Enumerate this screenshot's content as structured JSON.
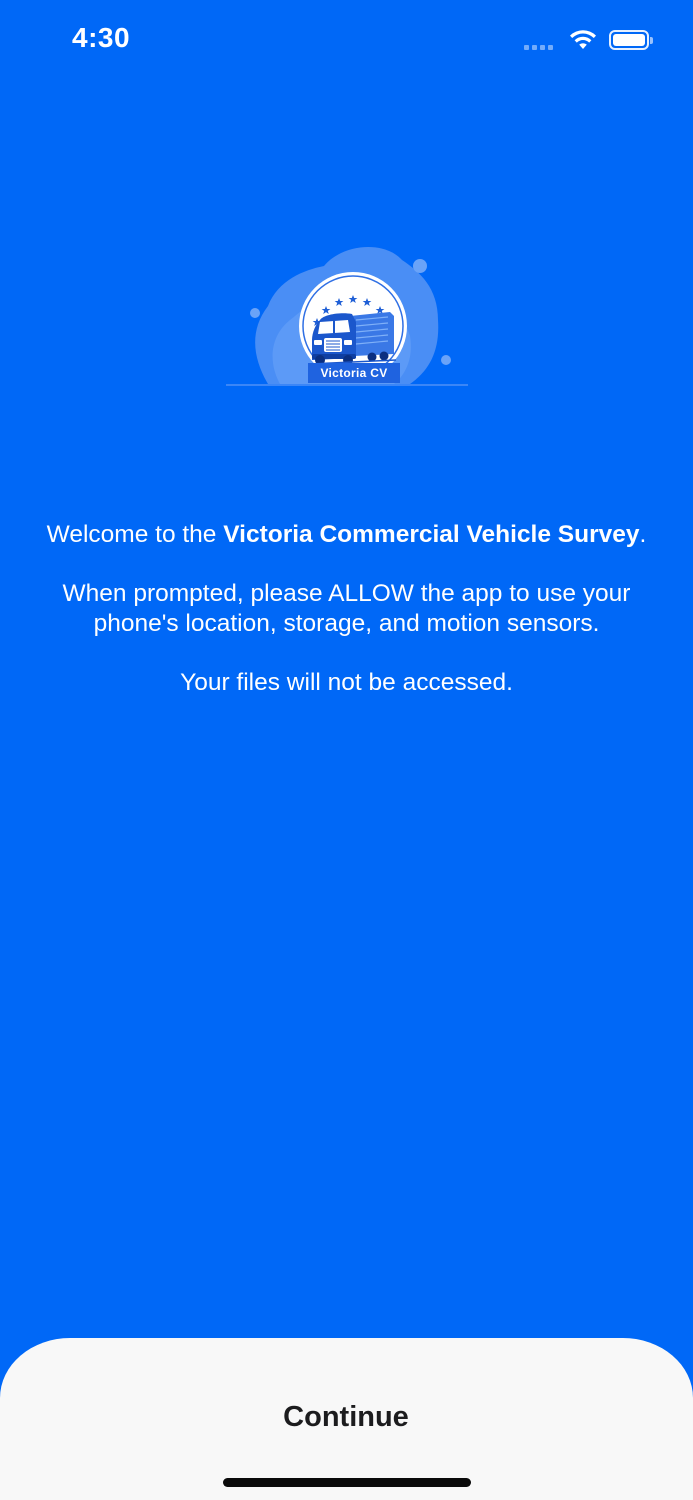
{
  "status_bar": {
    "time": "4:30",
    "signal_icon": "cellular-dots-icon",
    "wifi_icon": "wifi-icon",
    "battery_icon": "battery-icon",
    "battery_level": 1.0
  },
  "logo": {
    "label": "Victoria CV",
    "icon": "truck-icon",
    "stars_icon": "star-icon"
  },
  "welcome": {
    "line1_prefix": "Welcome to the ",
    "line1_bold": "Victoria Commercial Vehicle Survey",
    "line1_suffix": ".",
    "line2": "When prompted, please ALLOW the app to use your phone's location, storage, and motion sensors.",
    "line3": "Your files will not be accessed."
  },
  "bottom_sheet": {
    "continue_label": "Continue"
  },
  "colors": {
    "background": "#0068f7",
    "sheet": "#f8f8f8",
    "text_light": "#ffffff",
    "text_dark": "#1c1c1e"
  }
}
